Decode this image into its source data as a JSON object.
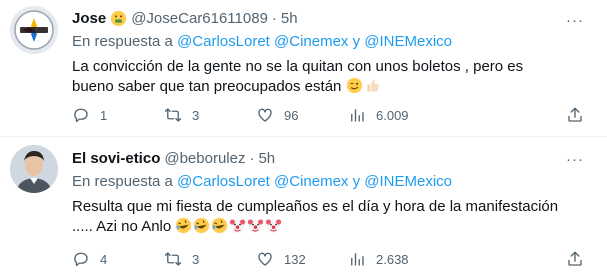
{
  "tweets": [
    {
      "author": {
        "name": "Jose",
        "handle": "@JoseCar61611089",
        "badge_icon": "money-mouth-emoji"
      },
      "time": "5h",
      "more_label": "···",
      "reply_prefix": "En respuesta a",
      "mentions": [
        "@CarlosLoret",
        "@Cinemex"
      ],
      "mention_joiner": "y",
      "mention_last": "@INEMexico",
      "text_line1": "La convicción de la gente no se la quitan con unos boletos , pero es",
      "text_line2": "bueno saber que tan preocupados están",
      "trailing_emojis": [
        "winking-face-emoji",
        "thumbs-up-emoji"
      ],
      "stats": {
        "replies": "1",
        "retweets": "3",
        "likes": "96",
        "views": "6.009"
      }
    },
    {
      "author": {
        "name": "El sovi-etico",
        "handle": "@beborulez"
      },
      "time": "5h",
      "more_label": "···",
      "reply_prefix": "En respuesta a",
      "mentions": [
        "@CarlosLoret",
        "@Cinemex"
      ],
      "mention_joiner": "y",
      "mention_last": "@INEMexico",
      "text_line1": "Resulta que mi fiesta de cumpleaños es el día y hora de la manifestación",
      "text_line2": "..... Azi no Anlo",
      "trailing_emojis": [
        "rofl-emoji",
        "rofl-emoji",
        "rofl-emoji",
        "clown-face-emoji",
        "clown-face-emoji",
        "clown-face-emoji"
      ],
      "stats": {
        "replies": "4",
        "retweets": "3",
        "likes": "132",
        "views": "2.638"
      }
    }
  ],
  "colors": {
    "text": "#0f1419",
    "muted": "#536471",
    "link": "#1d9bf0",
    "divider": "#eff3f4"
  }
}
